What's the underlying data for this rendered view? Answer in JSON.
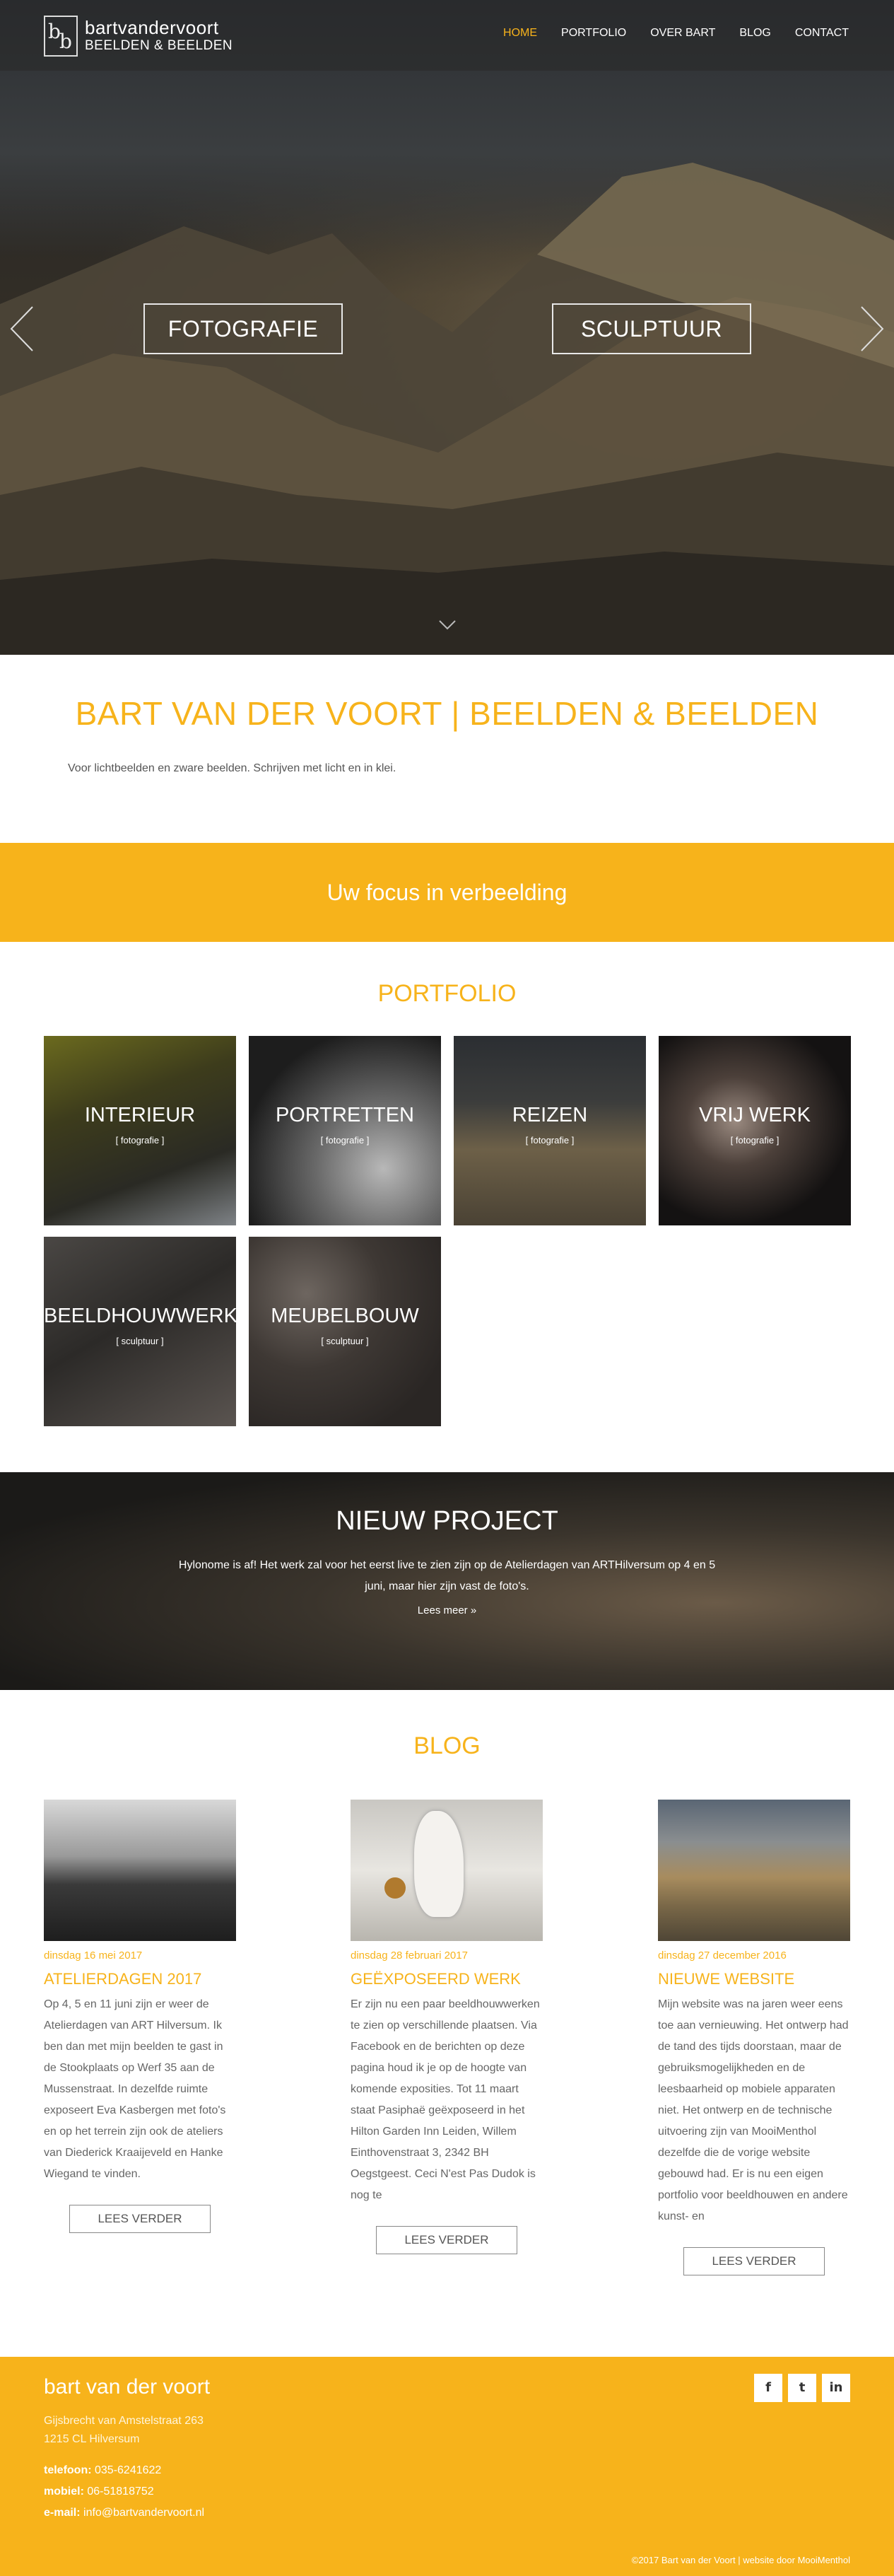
{
  "header": {
    "logo_line1": "bartvandervoort",
    "logo_line2": "BEELDEN & BEELDEN",
    "nav": [
      "HOME",
      "PORTFOLIO",
      "OVER BART",
      "BLOG",
      "CONTACT"
    ],
    "active_nav": "HOME",
    "accent": "#f7b31b"
  },
  "hero": {
    "buttons": [
      "FOTOGRAFIE",
      "SCULPTUUR"
    ],
    "icons": [
      "chevron-left-icon",
      "chevron-right-icon",
      "chevron-down-icon"
    ]
  },
  "intro": {
    "title": "BART VAN DER VOORT | BEELDEN & BEELDEN",
    "text": "Voor lichtbeelden en zware beelden. Schrijven met licht en in klei."
  },
  "banner": {
    "text": "Uw focus in verbeelding"
  },
  "portfolio": {
    "title": "PORTFOLIO",
    "tiles": [
      {
        "title": "INTERIEUR",
        "sub": "[ fotografie ]"
      },
      {
        "title": "PORTRETTEN",
        "sub": "[ fotografie ]"
      },
      {
        "title": "REIZEN",
        "sub": "[ fotografie ]"
      },
      {
        "title": "VRIJ WERK",
        "sub": "[ fotografie ]"
      },
      {
        "title": "BEELDHOUWWERK",
        "sub": "[ sculptuur ]"
      },
      {
        "title": "MEUBELBOUW",
        "sub": "[ sculptuur ]"
      }
    ]
  },
  "project": {
    "title": "NIEUW PROJECT",
    "text": "Hylonome is af! Het werk zal voor het eerst live te zien zijn op de Atelierdagen van ARTHilversum op 4 en 5 juni, maar hier zijn vast de foto's.",
    "more": "Lees meer »"
  },
  "blog": {
    "title": "BLOG",
    "posts": [
      {
        "date": "dinsdag 16 mei 2017",
        "title": "ATELIERDAGEN 2017",
        "body": "Op 4, 5 en 11 juni zijn er weer de Atelierdagen van ART Hilversum. Ik ben dan met mijn beelden te gast in de Stookplaats op Werf 35 aan de Mussenstraat. In dezelfde ruimte exposeert Eva Kasbergen met foto's en op het terrein zijn ook de ateliers van Diederick Kraaijeveld en Hanke Wiegand te vinden.",
        "read": "LEES VERDER"
      },
      {
        "date": "dinsdag 28 februari 2017",
        "title": "GEËXPOSEERD WERK",
        "body": "Er zijn nu een paar beeldhouwwerken te zien op verschillende plaatsen. Via Facebook en de berichten op deze pagina houd ik je op de hoogte van komende exposities.   Tot 11 maart staat Pasiphaë geëxposeerd in het Hilton Garden Inn Leiden, Willem Einthovenstraat 3, 2342 BH Oegstgeest.   Ceci N'est Pas Dudok is nog te",
        "read": "LEES VERDER"
      },
      {
        "date": "dinsdag 27 december 2016",
        "title": "NIEUWE WEBSITE",
        "body": "Mijn website was na jaren weer eens toe aan vernieuwing. Het ontwerp had de tand des tijds doorstaan, maar de gebruiksmogelijkheden en de leesbaarheid op mobiele apparaten niet. Het ontwerp en de technische uitvoering zijn van MooiMenthol dezelfde die de vorige website gebouwd had. Er is nu een eigen portfolio voor beeldhouwen en andere kunst- en",
        "read": "LEES VERDER"
      }
    ]
  },
  "footer": {
    "name": "bart van der voort",
    "address1": "Gijsbrecht van Amstelstraat 263",
    "address2": "1215 CL Hilversum",
    "phone_label": "telefoon:",
    "phone": "035-6241622",
    "mobile_label": "mobiel:",
    "mobile": "06-51818752",
    "email_label": "e-mail:",
    "email": "info@bartvandervoort.nl",
    "social": [
      "f",
      "t",
      "in"
    ],
    "copyright": "©2017 Bart van der Voort | website door MooiMenthol"
  }
}
